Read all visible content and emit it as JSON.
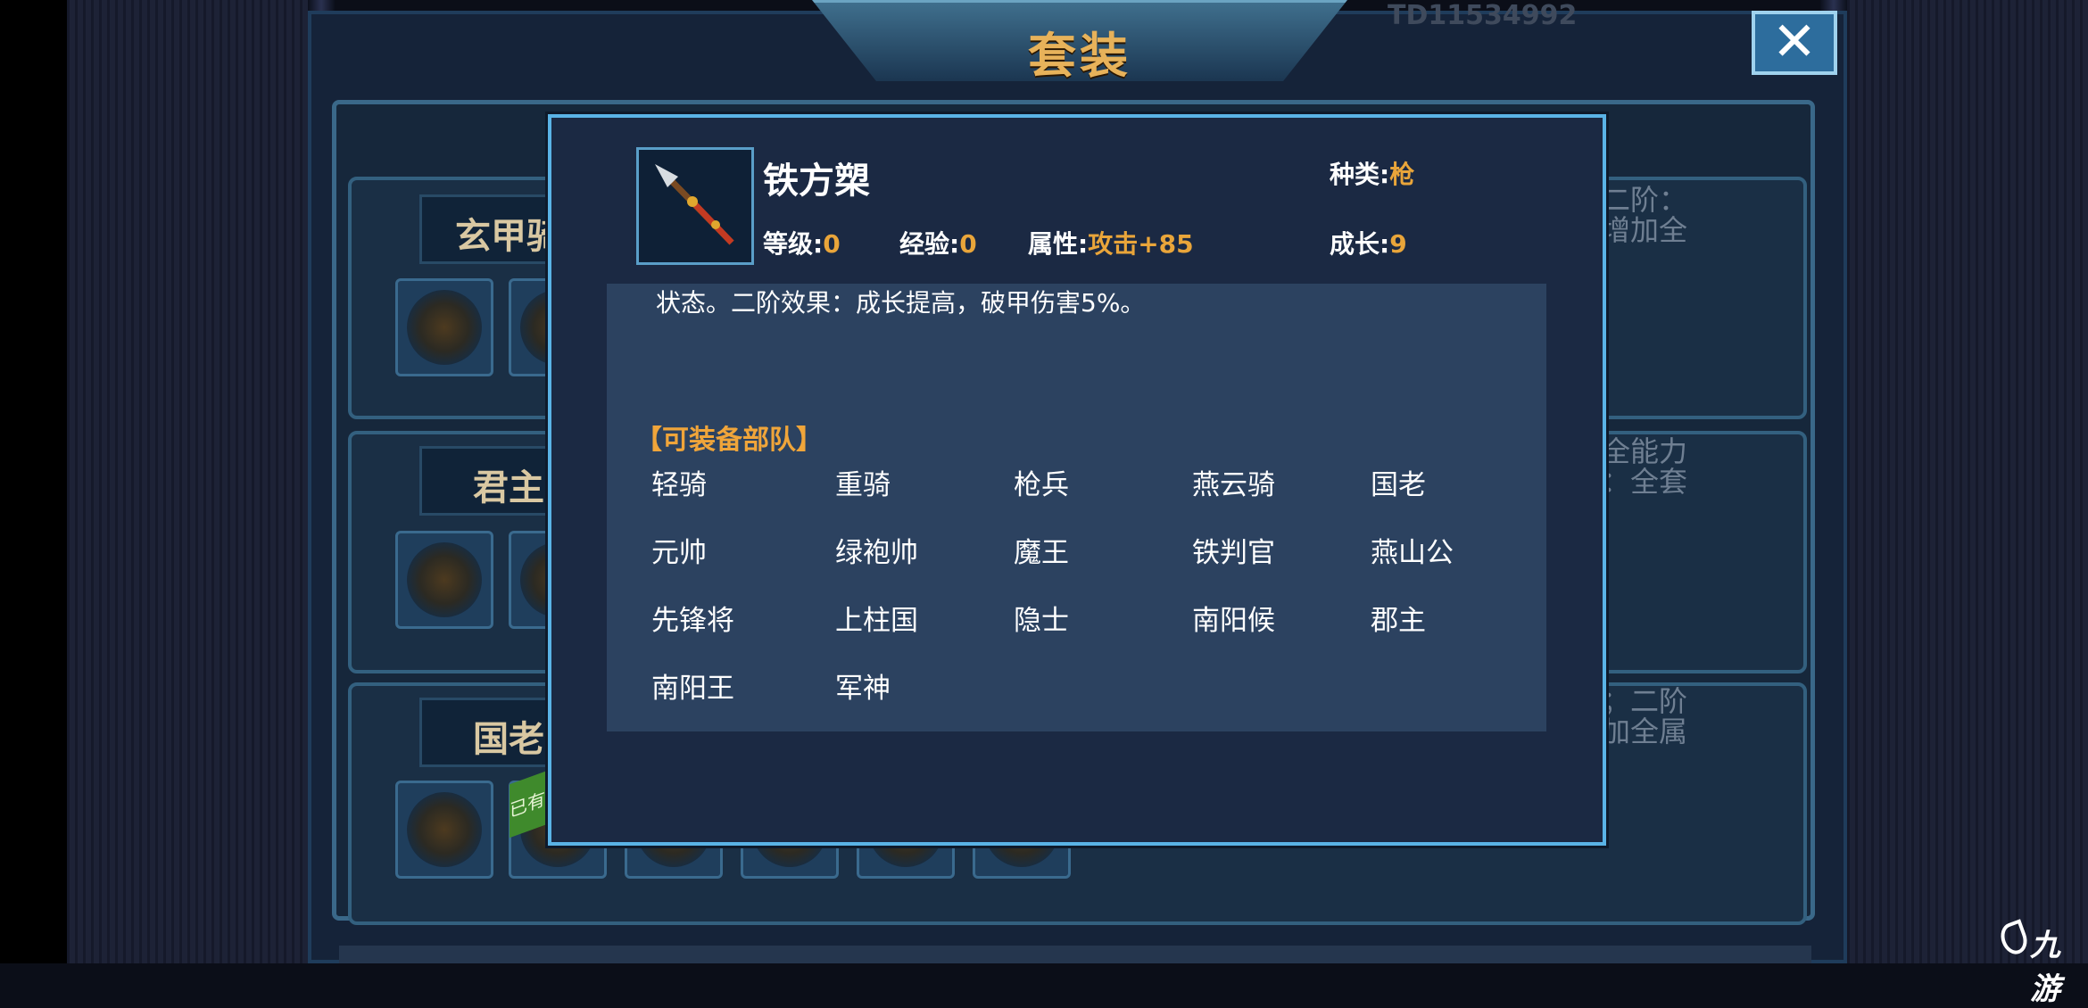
{
  "window": {
    "title": "套装",
    "top_number": "TD11534992",
    "close_label": "✕"
  },
  "sets": [
    {
      "name": "玄甲骑",
      "side_text": [
        "二阶：",
        "增加全"
      ]
    },
    {
      "name": "君主",
      "side_text": [
        "全能力",
        "：全套"
      ]
    },
    {
      "name": "国老",
      "side_text": [
        "；二阶",
        "加全属"
      ],
      "owned_tag": "已有"
    }
  ],
  "popup": {
    "item_icon": "spear-icon",
    "item_name": "铁方槊",
    "category": {
      "label": "种类",
      "value": "枪"
    },
    "level": {
      "label": "等级",
      "value": "0"
    },
    "exp": {
      "label": "经验",
      "value": "0"
    },
    "attribute": {
      "label": "属性",
      "value": "攻击+85"
    },
    "growth": {
      "label": "成长",
      "value": "9"
    },
    "description": "状态。二阶效果：成长提高，破甲伤害5%。",
    "troops_header": "【可装备部队】",
    "troops": [
      [
        "轻骑",
        "重骑",
        "枪兵",
        "燕云骑",
        "国老"
      ],
      [
        "元帅",
        "绿袍帅",
        "魔王",
        "铁判官",
        "燕山公"
      ],
      [
        "先锋将",
        "上柱国",
        "隐士",
        "南阳候",
        "郡主"
      ],
      [
        "南阳王",
        "军神"
      ]
    ]
  },
  "watermark": "九游",
  "colors": {
    "accent_gold": "#e9a53a",
    "title_gold": "#e7b25a",
    "popup_border": "#5ab3e6"
  }
}
